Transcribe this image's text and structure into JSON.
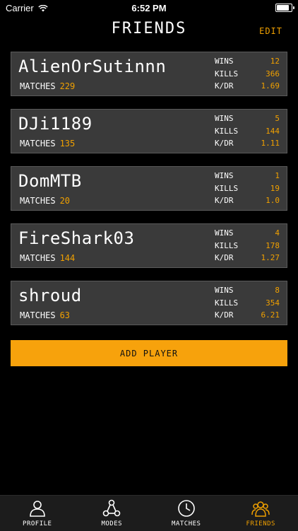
{
  "status": {
    "carrier": "Carrier",
    "time": "6:52 PM",
    "battery_level": 0.95
  },
  "header": {
    "title": "FRIENDS",
    "edit_label": "EDIT"
  },
  "stat_labels": {
    "wins": "WINS",
    "kills": "KILLS",
    "kd": "K/DR",
    "matches": "MATCHES"
  },
  "friends": [
    {
      "name": "AlienOrSutinnn",
      "matches": "229",
      "wins": "12",
      "kills": "366",
      "kd": "1.69"
    },
    {
      "name": "DJi1189",
      "matches": "135",
      "wins": "5",
      "kills": "144",
      "kd": "1.11"
    },
    {
      "name": "DomMTB",
      "matches": "20",
      "wins": "1",
      "kills": "19",
      "kd": "1.0"
    },
    {
      "name": "FireShark03",
      "matches": "144",
      "wins": "4",
      "kills": "178",
      "kd": "1.27"
    },
    {
      "name": "shroud",
      "matches": "63",
      "wins": "8",
      "kills": "354",
      "kd": "6.21"
    }
  ],
  "add_player_label": "ADD PLAYER",
  "tabs": [
    {
      "label": "PROFILE",
      "icon": "person-icon",
      "active": false
    },
    {
      "label": "MODES",
      "icon": "nodes-icon",
      "active": false
    },
    {
      "label": "MATCHES",
      "icon": "clock-icon",
      "active": false
    },
    {
      "label": "FRIENDS",
      "icon": "group-icon",
      "active": true
    }
  ],
  "colors": {
    "accent": "#f0a000",
    "card": "#3a3a3a",
    "background": "#000000"
  }
}
